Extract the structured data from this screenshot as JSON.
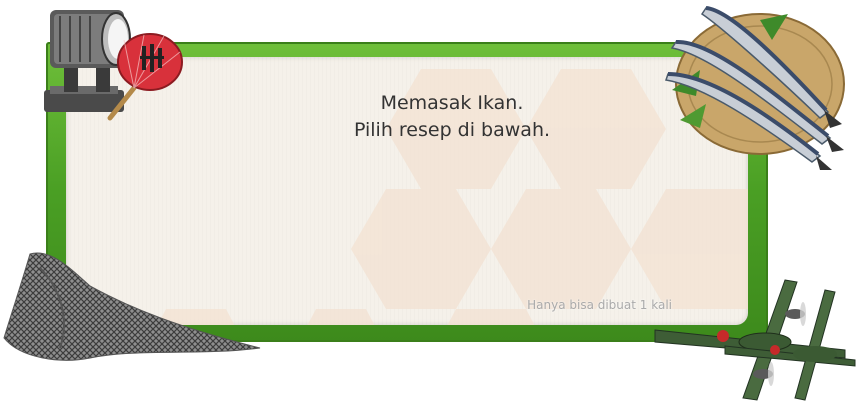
{
  "dialog": {
    "line1": "Memasak Ikan.",
    "line2": "Pilih resep di bawah.",
    "note": "Hanya bisa dibuat 1 kali"
  },
  "decorations": {
    "top_left": [
      "searchlight-icon",
      "uchiwa-fan-icon"
    ],
    "top_right": "saury-fish-plate-icon",
    "bottom_left": "fishing-net-icon",
    "bottom_right": "aircraft-icon"
  },
  "colors": {
    "frame_green": "#4a9f24",
    "panel_bg": "#f5f1ea",
    "hex": "#f3e2d2",
    "fan_red": "#d8313b"
  }
}
